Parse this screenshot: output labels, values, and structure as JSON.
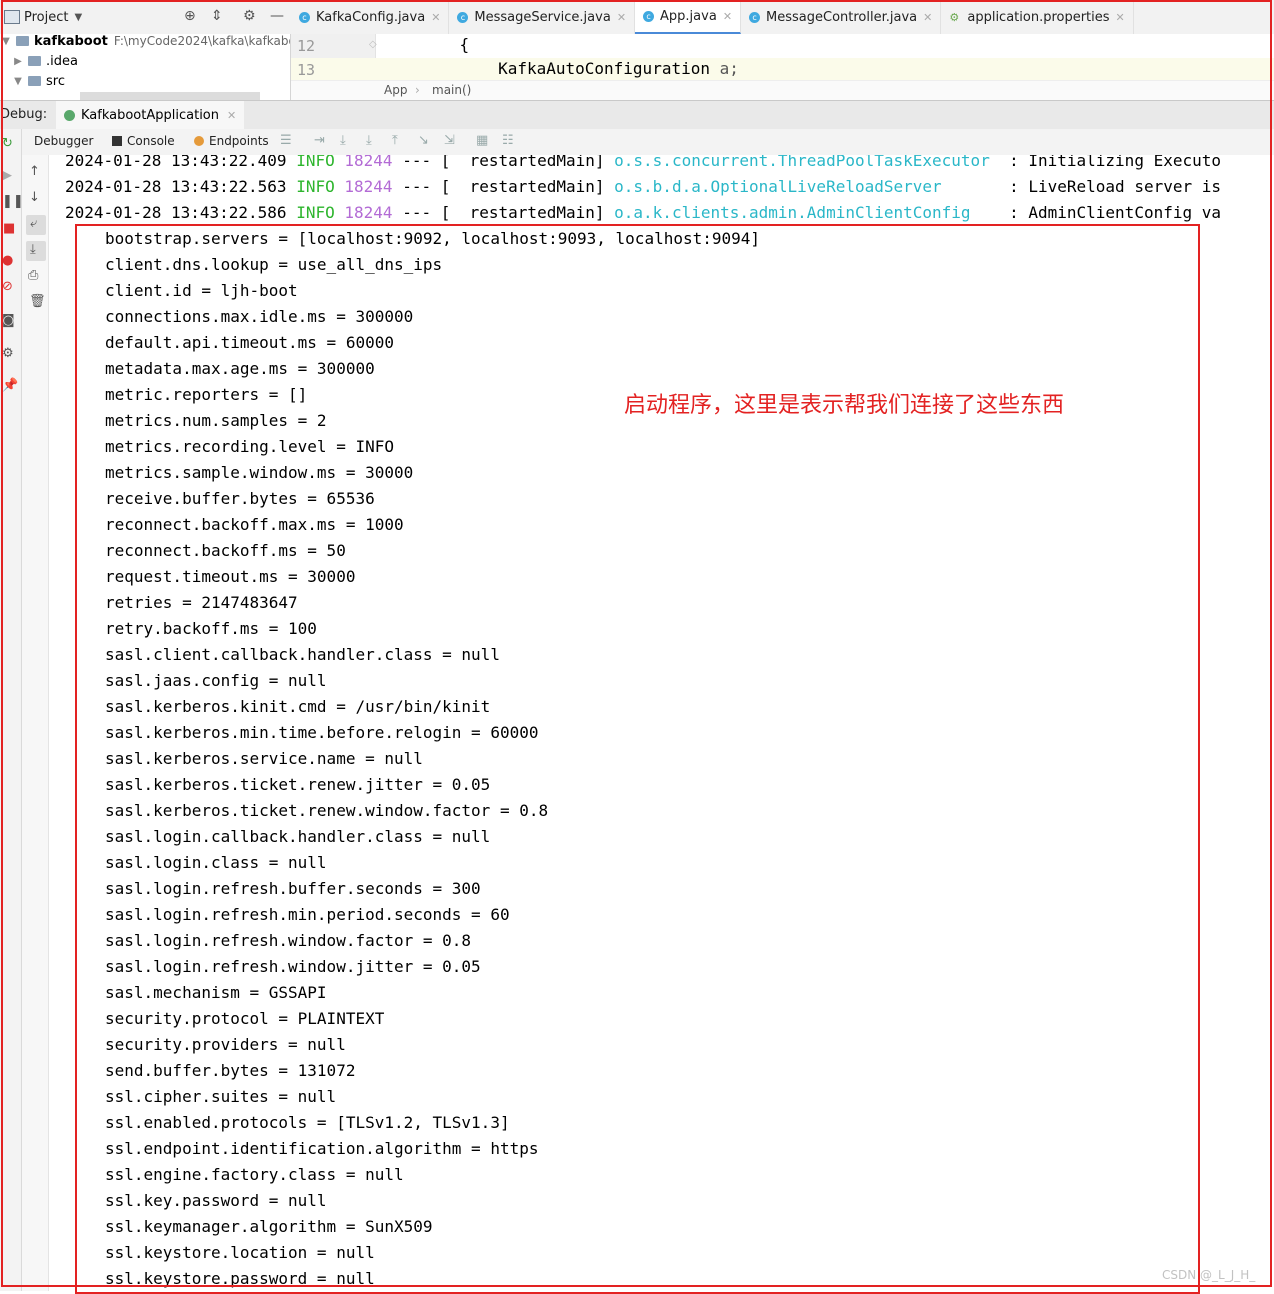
{
  "project_panel": {
    "title": "Project",
    "tree": [
      {
        "name": "kafkaboot",
        "path": "F:\\myCode2024\\kafka\\kafkaboot"
      },
      {
        "name": ".idea"
      },
      {
        "name": "src"
      }
    ]
  },
  "editor_tabs": [
    {
      "label": "KafkaConfig.java",
      "kind": "class"
    },
    {
      "label": "MessageService.java",
      "kind": "class"
    },
    {
      "label": "App.java",
      "kind": "class",
      "active": true
    },
    {
      "label": "MessageController.java",
      "kind": "class"
    },
    {
      "label": "application.properties",
      "kind": "properties"
    }
  ],
  "editor": {
    "lines": [
      {
        "number": "12",
        "code": "    {"
      },
      {
        "number": "13",
        "code": "        KafkaAutoConfiguration",
        "var": "a;"
      }
    ],
    "breadcrumbs": [
      "App",
      "main()"
    ]
  },
  "debug": {
    "label": "Debug:",
    "session": "KafkabootApplication",
    "tool_tabs": [
      "Debugger",
      "Console",
      "Endpoints"
    ]
  },
  "console": {
    "log_lines": [
      {
        "timestamp": "2024-01-28 13:43:22.409",
        "level": "INFO",
        "pid": "18244",
        "sep": "---",
        "thread": "[  restartedMain]",
        "logger": "o.s.s.concurrent.ThreadPoolTaskExecutor ",
        "message": " : Initializing Executo"
      },
      {
        "timestamp": "2024-01-28 13:43:22.563",
        "level": "INFO",
        "pid": "18244",
        "sep": "---",
        "thread": "[  restartedMain]",
        "logger": "o.s.b.d.a.OptionalLiveReloadServer      ",
        "message": " : LiveReload server is"
      },
      {
        "timestamp": "2024-01-28 13:43:22.586",
        "level": "INFO",
        "pid": "18244",
        "sep": "---",
        "thread": "[  restartedMain]",
        "logger": "o.a.k.clients.admin.AdminClientConfig   ",
        "message": " : AdminClientConfig va"
      }
    ],
    "config_lines": [
      "bootstrap.servers = [localhost:9092, localhost:9093, localhost:9094]",
      "client.dns.lookup = use_all_dns_ips",
      "client.id = ljh-boot",
      "connections.max.idle.ms = 300000",
      "default.api.timeout.ms = 60000",
      "metadata.max.age.ms = 300000",
      "metric.reporters = []",
      "metrics.num.samples = 2",
      "metrics.recording.level = INFO",
      "metrics.sample.window.ms = 30000",
      "receive.buffer.bytes = 65536",
      "reconnect.backoff.max.ms = 1000",
      "reconnect.backoff.ms = 50",
      "request.timeout.ms = 30000",
      "retries = 2147483647",
      "retry.backoff.ms = 100",
      "sasl.client.callback.handler.class = null",
      "sasl.jaas.config = null",
      "sasl.kerberos.kinit.cmd = /usr/bin/kinit",
      "sasl.kerberos.min.time.before.relogin = 60000",
      "sasl.kerberos.service.name = null",
      "sasl.kerberos.ticket.renew.jitter = 0.05",
      "sasl.kerberos.ticket.renew.window.factor = 0.8",
      "sasl.login.callback.handler.class = null",
      "sasl.login.class = null",
      "sasl.login.refresh.buffer.seconds = 300",
      "sasl.login.refresh.min.period.seconds = 60",
      "sasl.login.refresh.window.factor = 0.8",
      "sasl.login.refresh.window.jitter = 0.05",
      "sasl.mechanism = GSSAPI",
      "security.protocol = PLAINTEXT",
      "security.providers = null",
      "send.buffer.bytes = 131072",
      "ssl.cipher.suites = null",
      "ssl.enabled.protocols = [TLSv1.2, TLSv1.3]",
      "ssl.endpoint.identification.algorithm = https",
      "ssl.engine.factory.class = null",
      "ssl.key.password = null",
      "ssl.keymanager.algorithm = SunX509",
      "ssl.keystore.location = null",
      "ssl.keystore.password = null"
    ]
  },
  "annotation": {
    "text": "启动程序，这里是表示帮我们连接了这些东西",
    "color": "#e32222"
  },
  "watermark": "CSDN @_L_J_H_"
}
